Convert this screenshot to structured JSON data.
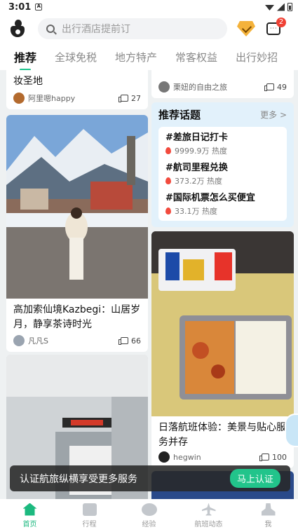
{
  "status": {
    "time": "3:01"
  },
  "header": {
    "search_placeholder": "出行酒店提前订",
    "message_badge": "2"
  },
  "tabs": [
    "推荐",
    "全球免税",
    "地方特产",
    "常客权益",
    "出行妙招"
  ],
  "feed": {
    "card_top_left": {
      "title": "妆圣地",
      "user": "阿里嗯happy",
      "likes": "27"
    },
    "card_top_right": {
      "title": "",
      "user": "栗妞的自由之旅",
      "likes": "49"
    },
    "topics": {
      "title": "推荐话题",
      "more": "更多 >",
      "items": [
        {
          "name": "#差旅日记打卡",
          "heat": "9999.9万 热度"
        },
        {
          "name": "#航司里程兑换",
          "heat": "373.2万 热度"
        },
        {
          "name": "#国际机票怎么买便宜",
          "heat": "33.1万 热度"
        }
      ]
    },
    "card_kazbegi": {
      "title": "高加索仙境Kazbegi：山居岁月，静享茶诗时光",
      "user": "凡凡S",
      "likes": "66"
    },
    "card_flight": {
      "title": "日落航班体验：美景与贴心服务并存",
      "user": "hegwin",
      "likes": "100"
    }
  },
  "banner": {
    "text": "认证航旅纵横享受更多服务",
    "button": "马上认证"
  },
  "tabbar": [
    {
      "label": "首页",
      "icon": "home-icon",
      "active": true
    },
    {
      "label": "行程",
      "icon": "suitcase-icon",
      "active": false
    },
    {
      "label": "经验",
      "icon": "chat-bubble-icon",
      "active": false
    },
    {
      "label": "航班动态",
      "icon": "plane-icon",
      "active": false
    },
    {
      "label": "我",
      "icon": "user-icon",
      "active": false
    }
  ],
  "colors": {
    "accent": "#1cb97f",
    "badge": "#f04134",
    "topic_bg": "#e2f1fb"
  }
}
